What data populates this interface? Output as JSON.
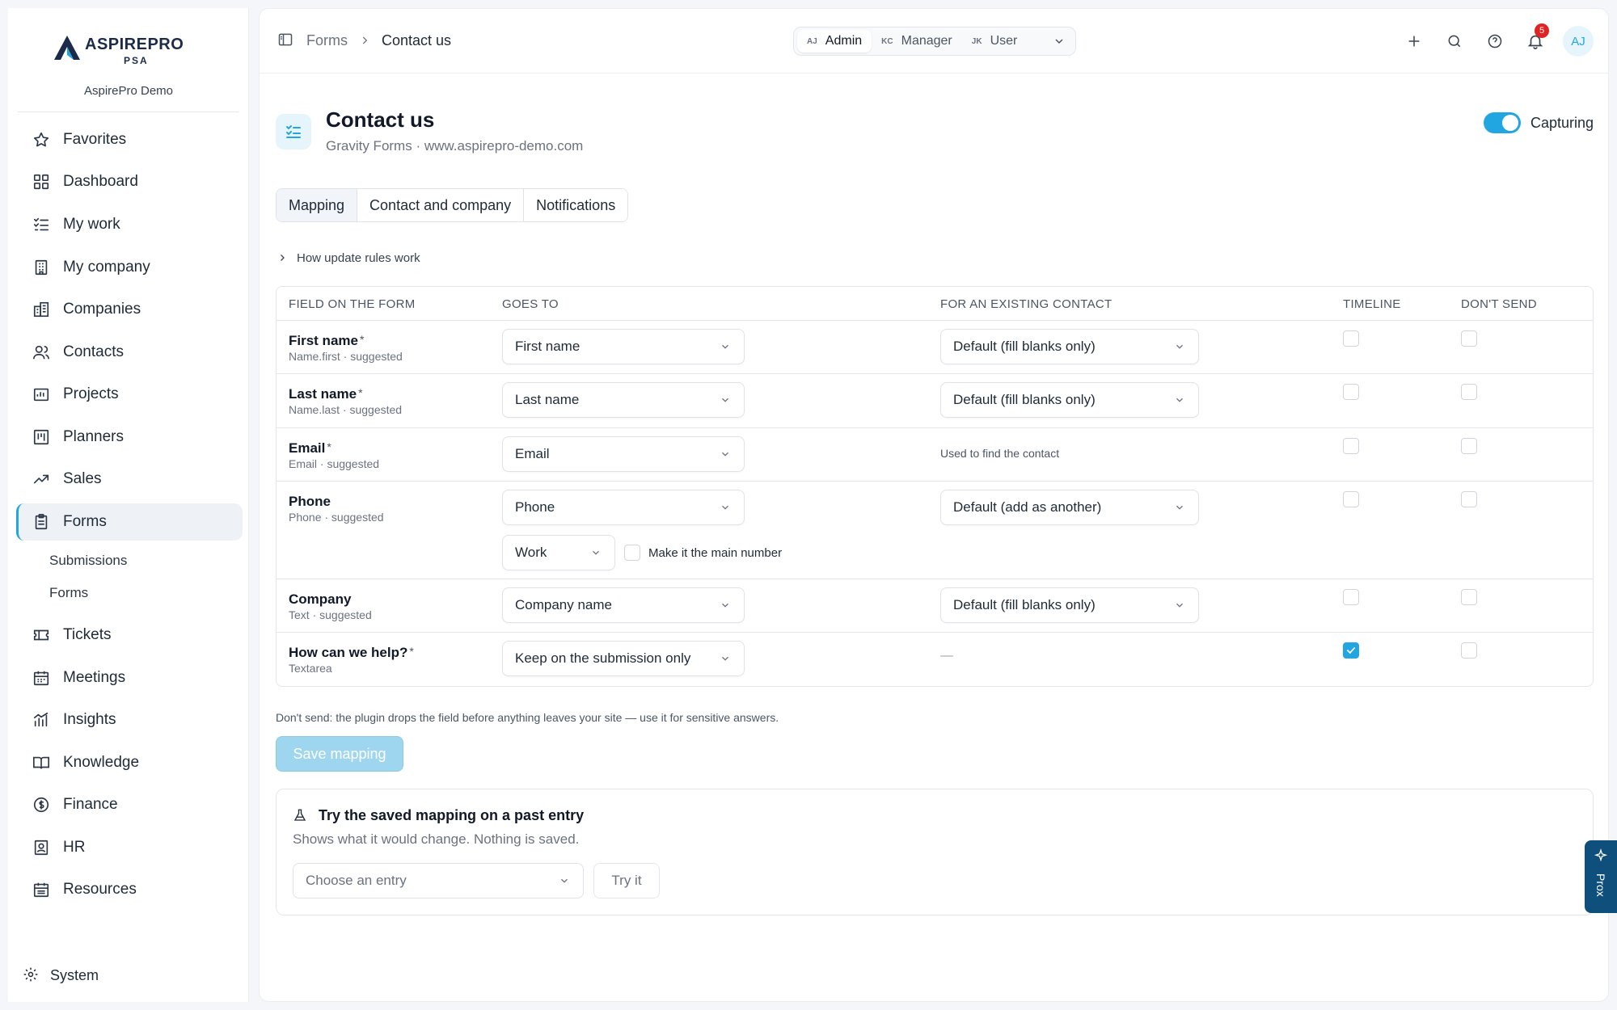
{
  "brand": {
    "name": "ASPIREPRO",
    "sub": "PSA",
    "org": "AspirePro Demo"
  },
  "sidebar": {
    "items": [
      {
        "label": "Favorites",
        "icon": "star-icon"
      },
      {
        "label": "Dashboard",
        "icon": "dashboard-icon"
      },
      {
        "label": "My work",
        "icon": "checklist-icon"
      },
      {
        "label": "My company",
        "icon": "building-icon"
      },
      {
        "label": "Companies",
        "icon": "buildings-icon"
      },
      {
        "label": "Contacts",
        "icon": "users-icon"
      },
      {
        "label": "Projects",
        "icon": "folder-icon"
      },
      {
        "label": "Planners",
        "icon": "kanban-icon"
      },
      {
        "label": "Sales",
        "icon": "trend-up-icon"
      },
      {
        "label": "Forms",
        "icon": "clipboard-icon"
      },
      {
        "label": "Tickets",
        "icon": "ticket-icon"
      },
      {
        "label": "Meetings",
        "icon": "calendar-icon"
      },
      {
        "label": "Insights",
        "icon": "bar-chart-icon"
      },
      {
        "label": "Knowledge",
        "icon": "book-icon"
      },
      {
        "label": "Finance",
        "icon": "dollar-icon"
      },
      {
        "label": "HR",
        "icon": "badge-icon"
      },
      {
        "label": "Resources",
        "icon": "calendar-grid-icon"
      }
    ],
    "subitems": [
      "Submissions",
      "Forms"
    ],
    "system": "System"
  },
  "topbar": {
    "breadcrumb": [
      "Forms",
      "Contact us"
    ],
    "roles": [
      {
        "initials": "AJ",
        "label": "Admin"
      },
      {
        "initials": "KC",
        "label": "Manager"
      },
      {
        "initials": "JK",
        "label": "User"
      }
    ],
    "notifications": "5",
    "avatar": "AJ"
  },
  "page": {
    "title": "Contact us",
    "subtitle": "Gravity Forms · www.aspirepro-demo.com",
    "toggle_label": "Capturing",
    "tabs": [
      "Mapping",
      "Contact and company",
      "Notifications"
    ],
    "howto": "How update rules work"
  },
  "table": {
    "headers": [
      "FIELD ON THE FORM",
      "GOES TO",
      "FOR AN EXISTING CONTACT",
      "TIMELINE",
      "DON'T SEND"
    ],
    "rows": [
      {
        "name": "First name",
        "req": "*",
        "sub": "Name.first · suggested",
        "goes_to": "First name",
        "existing": "Default (fill blanks only)"
      },
      {
        "name": "Last name",
        "req": "*",
        "sub": "Name.last · suggested",
        "goes_to": "Last name",
        "existing": "Default (fill blanks only)"
      },
      {
        "name": "Email",
        "req": "*",
        "sub": "Email · suggested",
        "goes_to": "Email",
        "existing_note": "Used to find the contact"
      },
      {
        "name": "Phone",
        "req": "",
        "sub": "Phone · suggested",
        "goes_to": "Phone",
        "existing": "Default (add as another)",
        "phone_type": "Work",
        "main_number_label": "Make it the main number"
      },
      {
        "name": "Company",
        "req": "",
        "sub": "Text · suggested",
        "goes_to": "Company name",
        "existing": "Default (fill blanks only)"
      },
      {
        "name": "How can we help?",
        "req": "*",
        "sub": "Textarea",
        "goes_to": "Keep on the submission only",
        "existing_dash": "—",
        "timeline_checked": true
      }
    ]
  },
  "footnote": "Don't send: the plugin drops the field before anything leaves your site — use it for sensitive answers.",
  "save_label": "Save mapping",
  "try": {
    "title": "Try the saved mapping on a past entry",
    "subtitle": "Shows what it would change. Nothing is saved.",
    "placeholder": "Choose an entry",
    "button": "Try it"
  },
  "prox_label": "Prox",
  "colors": {
    "accent": "#22a6e2",
    "badge": "#e02424",
    "save_disabled": "#9fd6ef"
  }
}
